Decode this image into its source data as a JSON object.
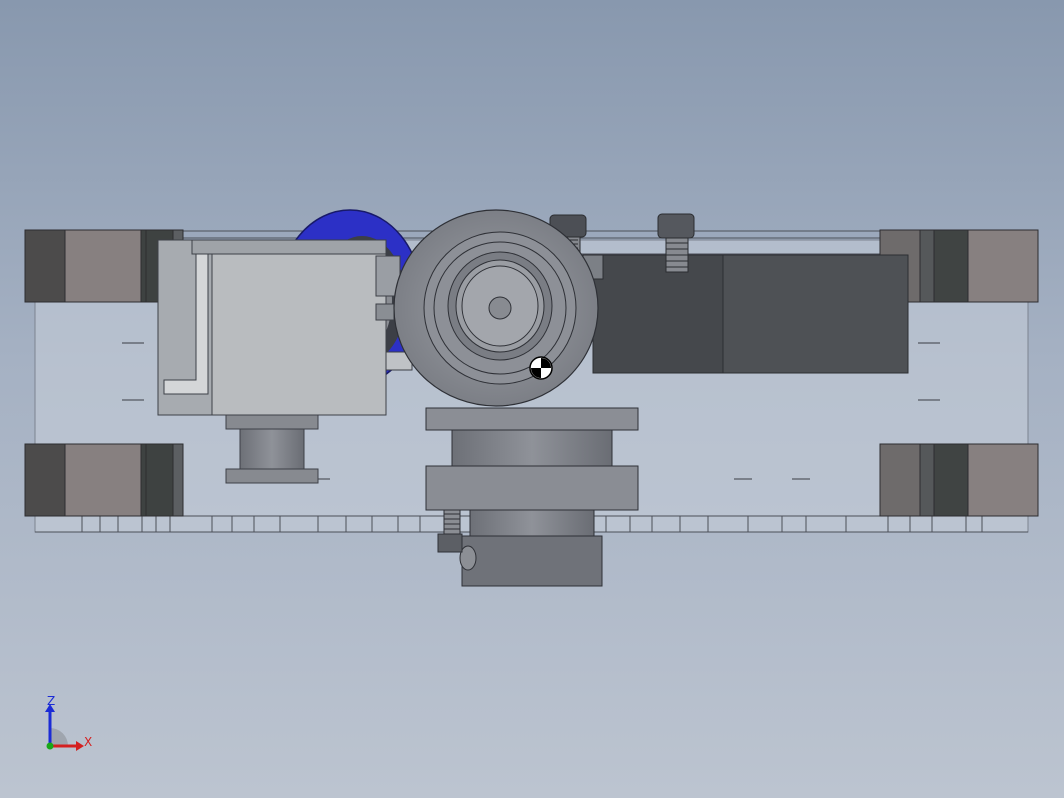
{
  "viewport": {
    "background_top": "#8898ae",
    "background_bottom": "#bcc4d0"
  },
  "model": {
    "description_colors": {
      "frame_edge": "#3a3d44",
      "transparent_plate": "#c5ccd6",
      "wheel_blue": "#2b2fc8",
      "dark_block": "#4a4d52",
      "light_block": "#b9bcbf",
      "pulley": "#8c8f96"
    }
  },
  "triad": {
    "z_label": "Z",
    "x_label": "X",
    "z_color": "#1b2bd6",
    "x_color": "#d42020",
    "origin_color": "#18a818"
  },
  "center_of_mass": {
    "icon": "center-of-mass-icon"
  }
}
